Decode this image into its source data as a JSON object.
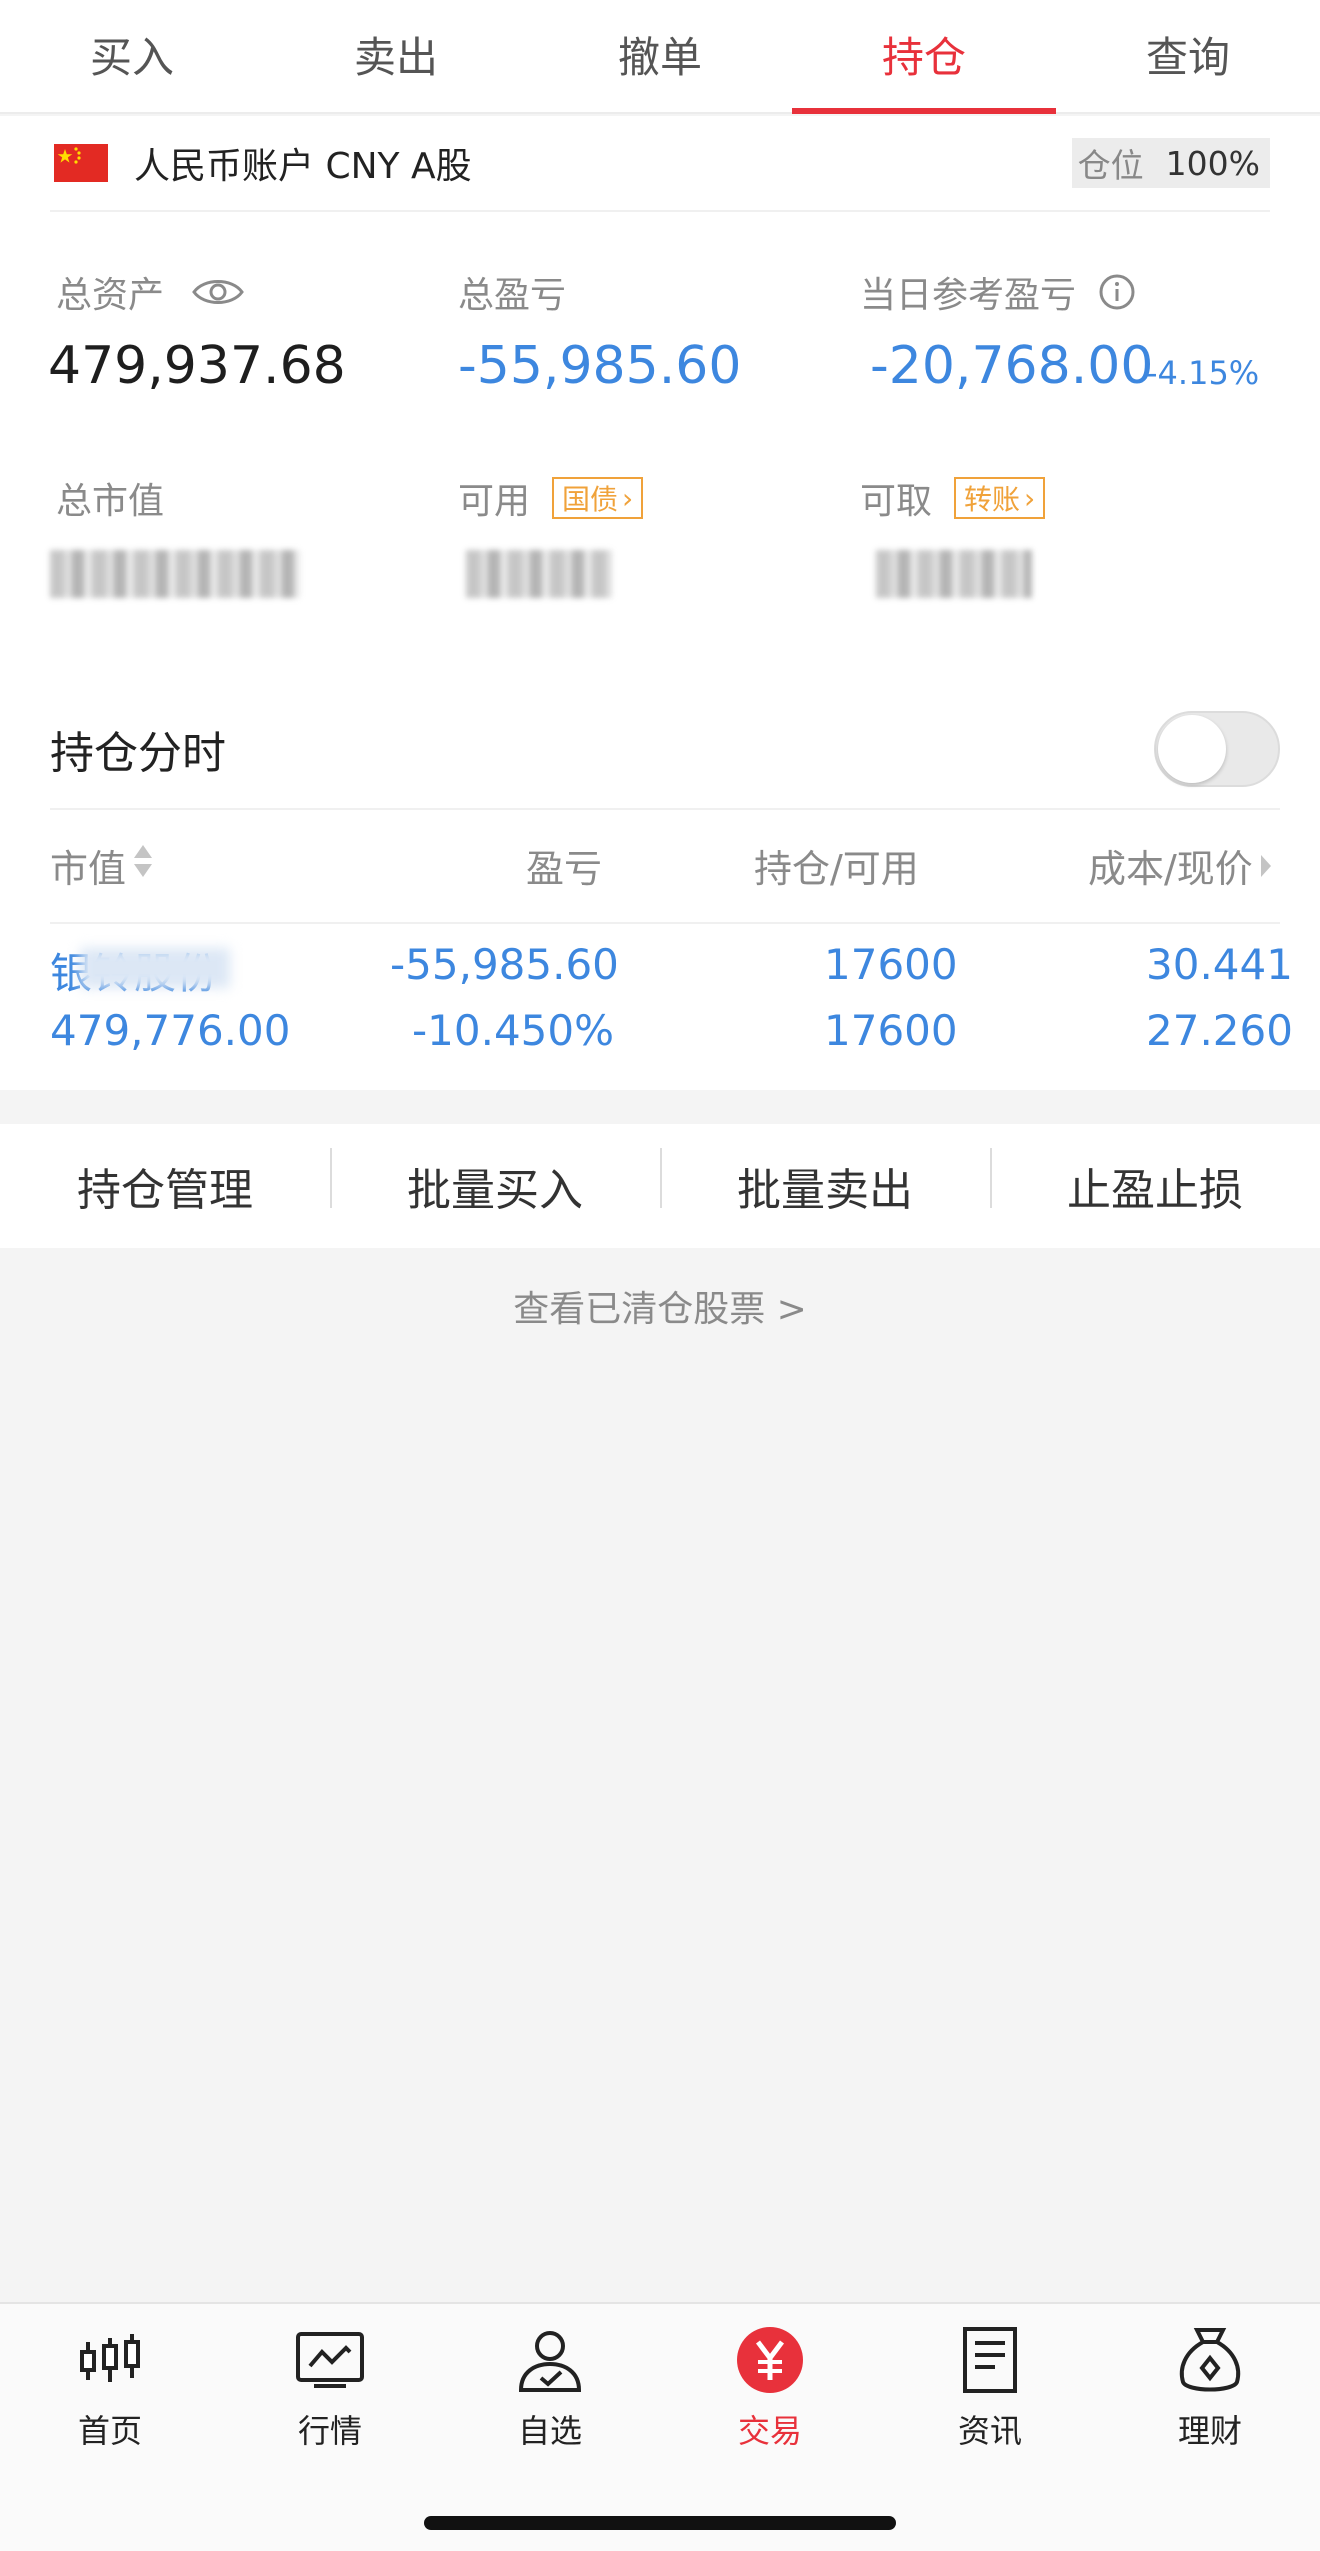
{
  "top_tabs": [
    {
      "label": "买入"
    },
    {
      "label": "卖出"
    },
    {
      "label": "撤单"
    },
    {
      "label": "持仓",
      "active": true
    },
    {
      "label": "查询"
    }
  ],
  "account": {
    "name": "人民币账户 CNY A股",
    "position_label": "仓位",
    "position_value": "100%"
  },
  "stats": {
    "total_assets_label": "总资产",
    "total_assets_value": "479,937.68",
    "total_pnl_label": "总盈亏",
    "total_pnl_value": "-55,985.60",
    "daily_pnl_label": "当日参考盈亏",
    "daily_pnl_value": "-20,768.00",
    "daily_pnl_pct": "-4.15%",
    "market_value_label": "总市值",
    "available_label": "可用",
    "available_tag": "国债",
    "withdrawable_label": "可取",
    "withdrawable_tag": "转账"
  },
  "positions": {
    "title": "持仓分时",
    "columns": [
      "市值",
      "盈亏",
      "持仓/可用",
      "成本/现价"
    ],
    "rows": [
      {
        "name": "银铃股份",
        "market_value": "479,776.00",
        "pnl": "-55,985.60",
        "pnl_pct": "-10.450%",
        "holding": "17600",
        "available": "17600",
        "cost": "30.441",
        "price": "27.260"
      }
    ]
  },
  "actions": [
    "持仓管理",
    "批量买入",
    "批量卖出",
    "止盈止损"
  ],
  "cleared_link": "查看已清仓股票 >",
  "bottom_nav": [
    {
      "label": "首页",
      "icon": "candlestick-icon"
    },
    {
      "label": "行情",
      "icon": "chart-icon"
    },
    {
      "label": "自选",
      "icon": "person-check-icon"
    },
    {
      "label": "交易",
      "icon": "yuan-icon",
      "active": true
    },
    {
      "label": "资讯",
      "icon": "document-icon"
    },
    {
      "label": "理财",
      "icon": "money-bag-icon"
    }
  ],
  "colors": {
    "accent_red": "#e8313b",
    "value_blue": "#3d87df",
    "tag_orange": "#f0a23a"
  }
}
